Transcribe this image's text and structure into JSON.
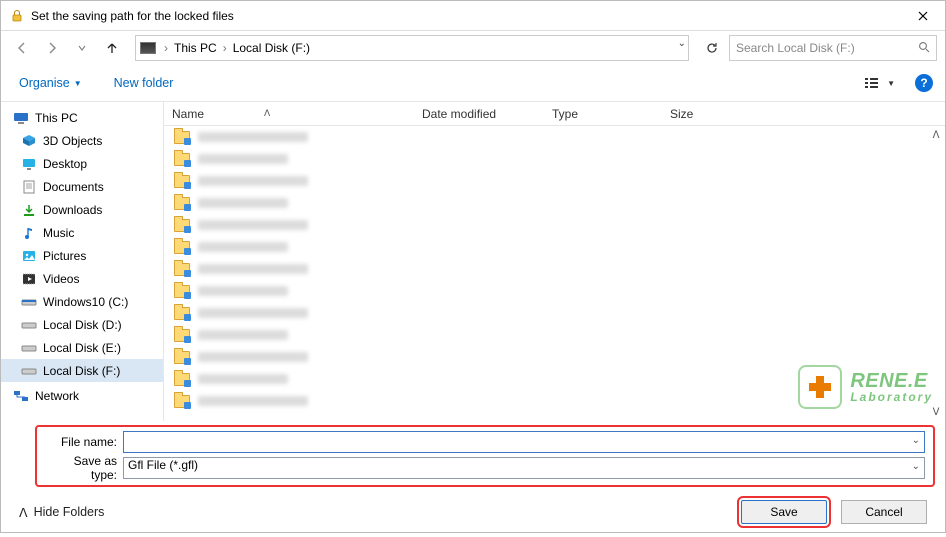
{
  "window": {
    "title": "Set the saving path for the locked files"
  },
  "breadcrumb": {
    "root": "This PC",
    "location": "Local Disk (F:)"
  },
  "search": {
    "placeholder": "Search Local Disk (F:)"
  },
  "toolbar": {
    "organise": "Organise",
    "new_folder": "New folder"
  },
  "columns": {
    "name": "Name",
    "date": "Date modified",
    "type": "Type",
    "size": "Size"
  },
  "tree": {
    "root": "This PC",
    "items": [
      "3D Objects",
      "Desktop",
      "Documents",
      "Downloads",
      "Music",
      "Pictures",
      "Videos",
      "Windows10 (C:)",
      "Local Disk (D:)",
      "Local Disk (E:)",
      "Local Disk (F:)"
    ],
    "network": "Network"
  },
  "fields": {
    "filename_label": "File name:",
    "filename_value": "",
    "type_label": "Save as type:",
    "type_value": "Gfl File (*.gfl)"
  },
  "footer": {
    "hide": "Hide Folders",
    "save": "Save",
    "cancel": "Cancel"
  },
  "watermark": {
    "line1": "RENE.E",
    "line2": "Laboratory"
  }
}
